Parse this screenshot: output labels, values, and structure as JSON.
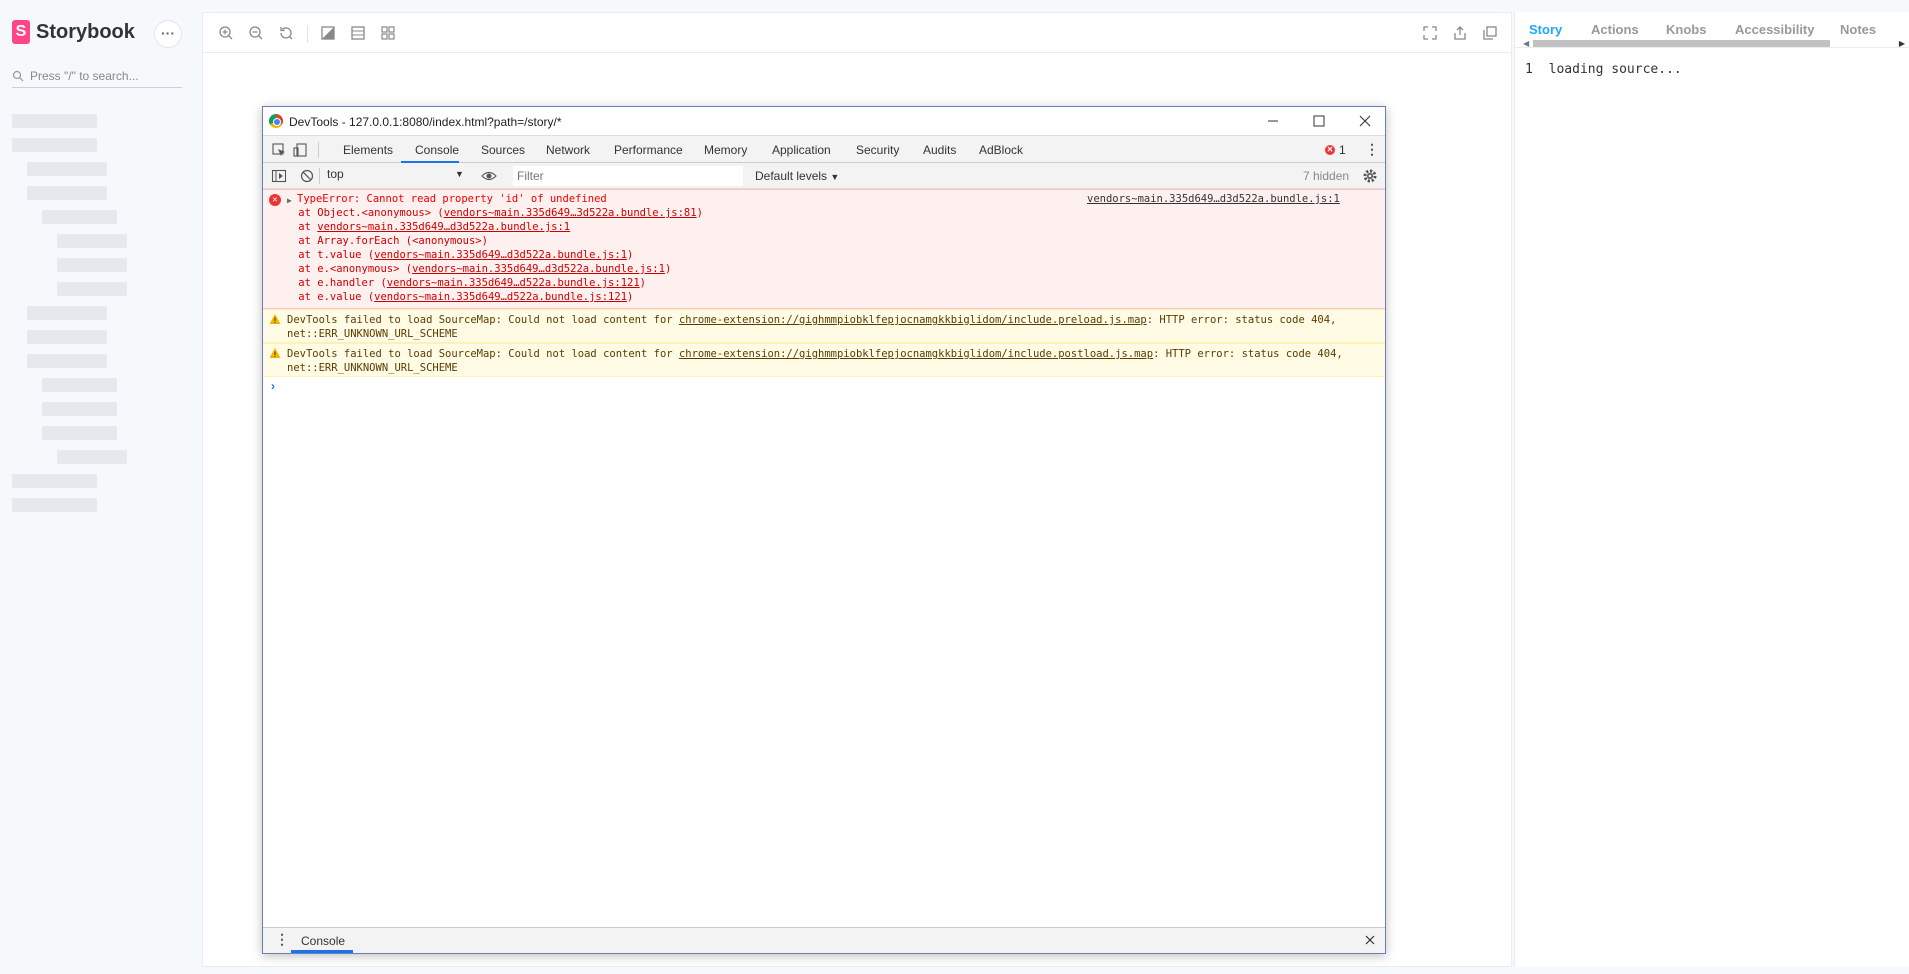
{
  "sidebar": {
    "brand": "Storybook",
    "brand_logo": "S",
    "menu_label": "···",
    "search_placeholder": "Press \"/\" to search..."
  },
  "toolbar": {
    "icons": [
      "zoom-in-icon",
      "zoom-out-icon",
      "zoom-reset-icon",
      "background-icon",
      "grid-icon",
      "outline-icon",
      "fullscreen-icon",
      "share-icon",
      "copy-icon"
    ]
  },
  "panel": {
    "tabs": [
      "Story",
      "Actions",
      "Knobs",
      "Accessibility",
      "Notes"
    ],
    "active_tab": "Story",
    "source_line_number": "1",
    "source_text": "loading source..."
  },
  "devtools": {
    "title": "DevTools - 127.0.0.1:8080/index.html?path=/story/*",
    "tabs": [
      "Elements",
      "Console",
      "Sources",
      "Network",
      "Performance",
      "Memory",
      "Application",
      "Security",
      "Audits",
      "AdBlock"
    ],
    "active_tab": "Console",
    "error_count": "1",
    "context": "top",
    "filter_placeholder": "Filter",
    "levels": "Default levels",
    "hidden": "7 hidden",
    "error": {
      "message": "TypeError: Cannot read property 'id' of undefined",
      "source": "vendors~main.335d649…d3d522a.bundle.js:1",
      "stack": [
        {
          "prefix": "    at Object.<anonymous> (",
          "link": "vendors~main.335d649…3d522a.bundle.js:81",
          "suffix": ")"
        },
        {
          "prefix": "    at ",
          "link": "vendors~main.335d649…d3d522a.bundle.js:1",
          "suffix": ""
        },
        {
          "prefix": "    at Array.forEach (<anonymous>)",
          "link": "",
          "suffix": ""
        },
        {
          "prefix": "    at t.value (",
          "link": "vendors~main.335d649…d3d522a.bundle.js:1",
          "suffix": ")"
        },
        {
          "prefix": "    at e.<anonymous> (",
          "link": "vendors~main.335d649…d3d522a.bundle.js:1",
          "suffix": ")"
        },
        {
          "prefix": "    at e.handler (",
          "link": "vendors~main.335d649…d522a.bundle.js:121",
          "suffix": ")"
        },
        {
          "prefix": "    at e.value (",
          "link": "vendors~main.335d649…d522a.bundle.js:121",
          "suffix": ")"
        }
      ]
    },
    "warnings": [
      {
        "before": "DevTools failed to load SourceMap: Could not load content for ",
        "link": "chrome-extension://gighmmpiobklfepjocnamgkkbiglidom/include.preload.js.map",
        "after": ": HTTP error: status code 404, net::ERR_UNKNOWN_URL_SCHEME"
      },
      {
        "before": "DevTools failed to load SourceMap: Could not load content for ",
        "link": "chrome-extension://gighmmpiobklfepjocnamgkkbiglidom/include.postload.js.map",
        "after": ": HTTP error: status code 404, net::ERR_UNKNOWN_URL_SCHEME"
      }
    ],
    "prompt": "›",
    "drawer_tab": "Console"
  }
}
